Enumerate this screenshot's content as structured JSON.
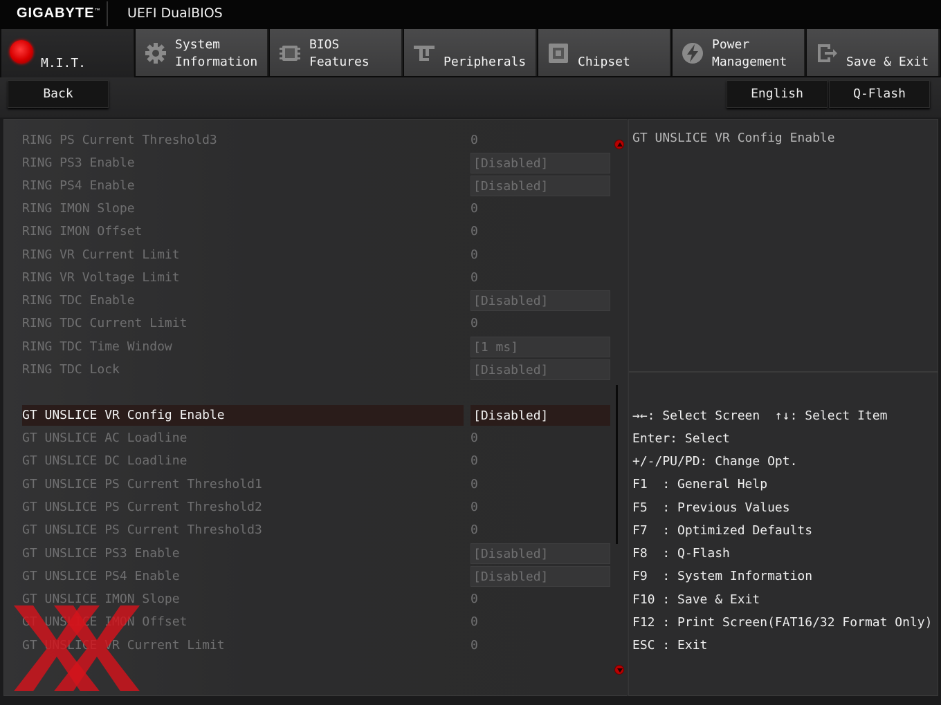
{
  "header": {
    "brand": "GIGABYTE",
    "brand_tm": "™",
    "product": "UEFI DualBIOS"
  },
  "tabs": [
    {
      "label": "M.I.T.",
      "icon": "mit-red-dot-icon",
      "active": true
    },
    {
      "label": "System\nInformation",
      "icon": "gear-icon"
    },
    {
      "label": "BIOS\nFeatures",
      "icon": "bios-chip-icon"
    },
    {
      "label": "Peripherals",
      "icon": "peripherals-icon"
    },
    {
      "label": "Chipset",
      "icon": "chipset-icon"
    },
    {
      "label": "Power\nManagement",
      "icon": "power-bolt-icon"
    },
    {
      "label": "Save & Exit",
      "icon": "exit-door-icon"
    }
  ],
  "toolbar": {
    "back": "Back",
    "language": "English",
    "qflash": "Q-Flash"
  },
  "settings": [
    {
      "name": "RING PS Current Threshold3",
      "value": "0"
    },
    {
      "name": "RING PS3 Enable",
      "value": "[Disabled]",
      "boxed": true
    },
    {
      "name": "RING PS4 Enable",
      "value": "[Disabled]",
      "boxed": true
    },
    {
      "name": "RING IMON Slope",
      "value": "0"
    },
    {
      "name": "RING IMON Offset",
      "value": "0"
    },
    {
      "name": "RING VR Current Limit",
      "value": "0"
    },
    {
      "name": "RING VR Voltage Limit",
      "value": "0"
    },
    {
      "name": "RING TDC Enable",
      "value": "[Disabled]",
      "boxed": true
    },
    {
      "name": "RING TDC Current Limit",
      "value": "0"
    },
    {
      "name": "RING TDC Time Window",
      "value": "[1 ms]",
      "boxed": true
    },
    {
      "name": "RING TDC Lock",
      "value": "[Disabled]",
      "boxed": true
    },
    {
      "name": "GT UNSLICE VR Config Enable",
      "value": "[Disabled]",
      "boxed": true,
      "selected": true
    },
    {
      "name": "GT UNSLICE AC Loadline",
      "value": "0"
    },
    {
      "name": "GT UNSLICE DC Loadline",
      "value": "0"
    },
    {
      "name": "GT UNSLICE PS Current Threshold1",
      "value": "0"
    },
    {
      "name": "GT UNSLICE PS Current Threshold2",
      "value": "0"
    },
    {
      "name": "GT UNSLICE PS Current Threshold3",
      "value": "0"
    },
    {
      "name": "GT UNSLICE PS3 Enable",
      "value": "[Disabled]",
      "boxed": true
    },
    {
      "name": "GT UNSLICE PS4 Enable",
      "value": "[Disabled]",
      "boxed": true
    },
    {
      "name": "GT UNSLICE IMON Slope",
      "value": "0"
    },
    {
      "name": "GT UNSLICE IMON Offset",
      "value": "0"
    },
    {
      "name": "GT UNSLICE VR Current Limit",
      "value": "0"
    }
  ],
  "help": {
    "title": "GT UNSLICE VR Config Enable"
  },
  "keys": [
    "→←: Select Screen  ↑↓: Select Item",
    "Enter: Select",
    "+/-/PU/PD: Change Opt.",
    "F1  : General Help",
    "F5  : Previous Values",
    "F7  : Optimized Defaults",
    "F8  : Q-Flash",
    "F9  : System Information",
    "F10 : Save & Exit",
    "F12 : Print Screen(FAT16/32 Format Only)",
    "ESC : Exit"
  ],
  "colors": {
    "accent": "#d80000",
    "selected_row": "#2a1c1a",
    "dim_text": "#6f6f70"
  }
}
